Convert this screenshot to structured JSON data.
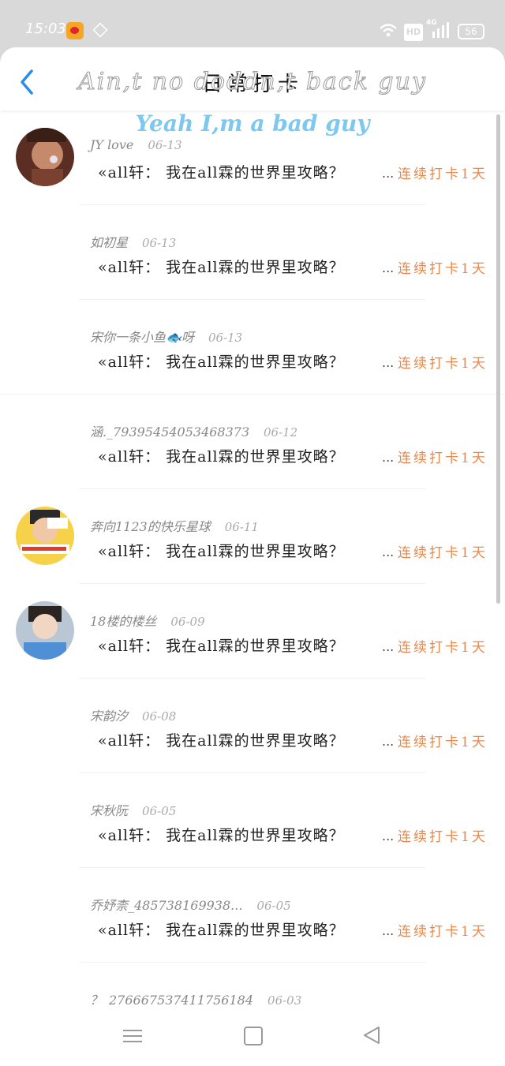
{
  "status_bar": {
    "time": "15:03",
    "hd": "HD",
    "network": "4G",
    "battery": "56"
  },
  "header": {
    "title": "日常打卡",
    "back_icon": "chevron-left-icon"
  },
  "overlay": {
    "line1": "Ain,t no doddn,t back guy",
    "line2": "Yeah I,m a bad guy"
  },
  "colors": {
    "accent": "#2a8ee4",
    "streak": "#e8874a",
    "status_bar": "#d9d9d9"
  },
  "items": [
    {
      "name": "JY love",
      "date": "06-13",
      "message": "«all轩： 我在all霖的世界里攻略？",
      "ellipsis": "...",
      "streak": "连续打卡1天",
      "avatar": "photo-avatar-1"
    },
    {
      "name": "如初星",
      "date": "06-13",
      "message": "«all轩： 我在all霖的世界里攻略？",
      "ellipsis": "...",
      "streak": "连续打卡1天",
      "avatar": ""
    },
    {
      "name": "宋你一条小鱼🐟呀",
      "date": "06-13",
      "message": "«all轩： 我在all霖的世界里攻略？",
      "ellipsis": "...",
      "streak": "连续打卡1天",
      "avatar": ""
    },
    {
      "name": "涵._7939545405346837З",
      "date": "06-12",
      "message": "«all轩： 我在all霖的世界里攻略？",
      "ellipsis": "...",
      "streak": "连续打卡1天",
      "avatar": ""
    },
    {
      "name": "奔向1123的快乐星球",
      "date": "06-11",
      "message": "«all轩： 我在all霖的世界里攻略？",
      "ellipsis": "...",
      "streak": "连续打卡1天",
      "avatar": "photo-avatar-2"
    },
    {
      "name": "18楼的楼丝",
      "date": "06-09",
      "message": "«all轩： 我在all霖的世界里攻略？",
      "ellipsis": "...",
      "streak": "连续打卡1天",
      "avatar": "photo-avatar-3"
    },
    {
      "name": "宋韵汐",
      "date": "06-08",
      "message": "«all轩： 我在all霖的世界里攻略？",
      "ellipsis": "...",
      "streak": "连续打卡1天",
      "avatar": ""
    },
    {
      "name": "宋秋阮",
      "date": "06-05",
      "message": "«all轩： 我在all霖的世界里攻略？",
      "ellipsis": "...",
      "streak": "连续打卡1天",
      "avatar": ""
    },
    {
      "name": "乔妤柰_485738169938...",
      "date": "06-05",
      "message": "«all轩： 我在all霖的世界里攻略？",
      "ellipsis": "...",
      "streak": "连续打卡1天",
      "avatar": ""
    },
    {
      "name": "？_2766675З7411756184",
      "date": "06-03",
      "message": "",
      "ellipsis": "",
      "streak": "",
      "avatar": ""
    }
  ],
  "nav_bar": {
    "menu_icon": "menu-icon",
    "home_icon": "home-square-icon",
    "back_icon": "back-triangle-icon"
  }
}
